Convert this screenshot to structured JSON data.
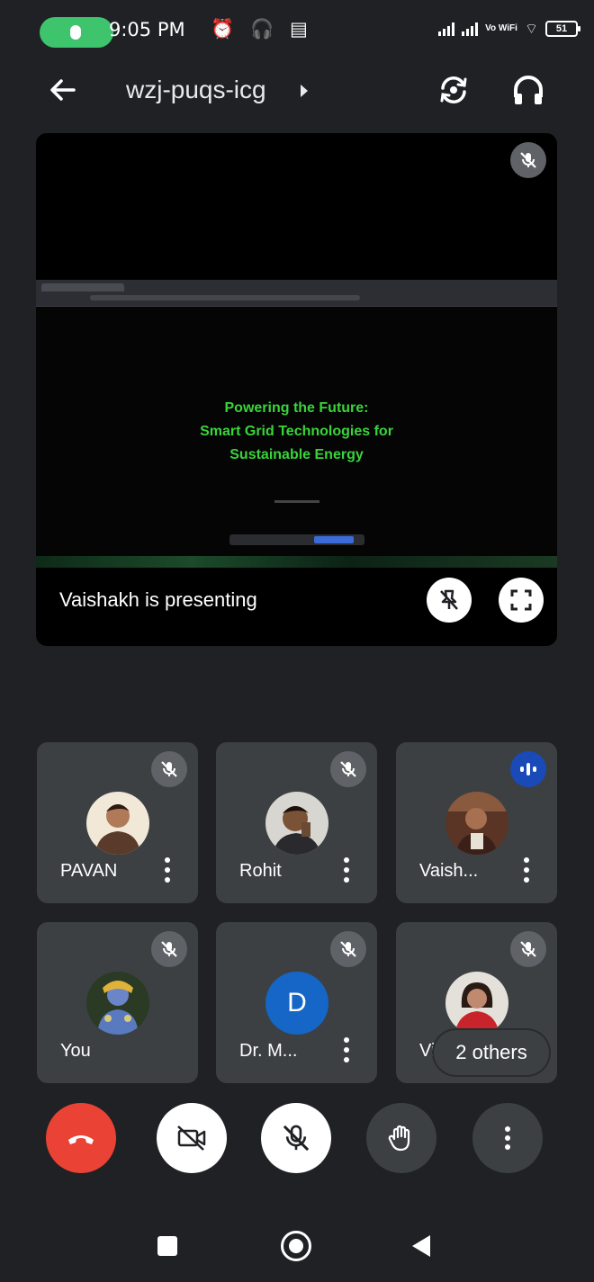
{
  "status_bar": {
    "time": "9:05 PM",
    "status_glyphs": "⏰ 🎧 ▤",
    "network": "Vo WiFi",
    "battery": "51"
  },
  "appbar": {
    "meeting_code": "wzj-puqs-icg",
    "icons": [
      "back-arrow-icon",
      "switch-camera-icon",
      "headphones-icon"
    ]
  },
  "presentation": {
    "slide_title_line1": "Powering the Future:",
    "slide_title_line2": "Smart Grid Technologies for",
    "slide_title_line3": "Sustainable Energy",
    "presenting_label": "Vaishakh is presenting"
  },
  "participants": [
    {
      "name": "PAVAN",
      "muted": true
    },
    {
      "name": "Rohit",
      "muted": true
    },
    {
      "name": "Vaish...",
      "muted": false,
      "speaking": true
    },
    {
      "name": "You",
      "muted": true
    },
    {
      "name": "Dr. M...",
      "muted": true,
      "initial": "D"
    },
    {
      "name": "Vi",
      "muted": true
    }
  ],
  "others_label": "2 others",
  "colors": {
    "background": "#202124",
    "tile": "#3c4043",
    "hangup": "#ea4335",
    "speaking": "#1a49b8",
    "slide_text": "#39d43a",
    "mic_pill": "#3ec46d"
  }
}
